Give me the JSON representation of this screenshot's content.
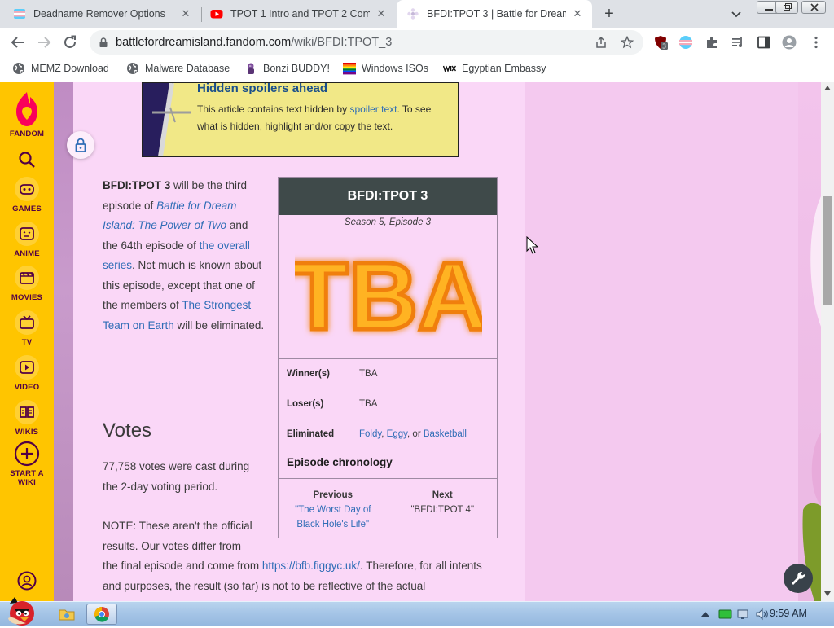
{
  "browser": {
    "tabs": [
      {
        "title": "Deadname Remover Options",
        "favicon": "trans-flag-icon"
      },
      {
        "title": "TPOT 1 Intro and TPOT 2 Com",
        "favicon": "youtube-icon"
      },
      {
        "title": "BFDI:TPOT 3 | Battle for Dream",
        "favicon": "fandom-flower-icon",
        "active": true
      }
    ],
    "url_host": "battlefordreamisland.fandom.com",
    "url_path": "/wiki/BFDI:TPOT_3",
    "extension_badge": "3"
  },
  "bookmarks": [
    {
      "label": "MEMZ Download",
      "icon": "globe-icon"
    },
    {
      "label": "Malware Database",
      "icon": "globe-icon"
    },
    {
      "label": "Bonzi BUDDY!",
      "icon": "bonzi-icon"
    },
    {
      "label": "Windows ISOs",
      "icon": "rainbow-flag-icon"
    },
    {
      "label": "Egyptian Embassy",
      "icon": "wix-icon"
    }
  ],
  "fandom_sidebar": {
    "brand": "FANDOM",
    "items": [
      {
        "label": "GAMES",
        "icon": "games-icon"
      },
      {
        "label": "ANIME",
        "icon": "anime-icon"
      },
      {
        "label": "MOVIES",
        "icon": "movies-icon"
      },
      {
        "label": "TV",
        "icon": "tv-icon"
      },
      {
        "label": "VIDEO",
        "icon": "video-icon"
      },
      {
        "label": "WIKIS",
        "icon": "wikis-icon"
      }
    ],
    "start_wiki": "START A WIKI"
  },
  "spoiler": {
    "heading": "Hidden spoilers ahead",
    "text_before": "This article contains text hidden by ",
    "link": "spoiler text",
    "text_after": ". To see what is hidden, highlight and/or copy the text."
  },
  "article": {
    "subject": "BFDI:TPOT 3",
    "t1": " will be the third episode of ",
    "link1": "Battle for Dream Island: The Power of Two",
    "t2": " and the 64th episode of ",
    "link2": "the overall series",
    "t3": ". Not much is known about this episode, except that one of the members of ",
    "link3": "The Strongest Team on Earth",
    "t4": " will be eliminated."
  },
  "infobox": {
    "title": "BFDI:TPOT 3",
    "subtitle": "Season 5, Episode 3",
    "image_text": "TBA",
    "rows": [
      {
        "key": "Winner(s)",
        "value": "TBA"
      },
      {
        "key": "Loser(s)",
        "value": "TBA"
      }
    ],
    "eliminated_key": "Eliminated",
    "eliminated": [
      "Foldy",
      "Eggy",
      "Basketball"
    ],
    "eliminated_sep1": ", ",
    "eliminated_sep2": ", or ",
    "chronology_heading": "Episode chronology",
    "previous_label": "Previous",
    "previous_value": "\"The Worst Day of Black Hole's Life\"",
    "next_label": "Next",
    "next_value": "\"BFDI:TPOT 4\""
  },
  "votes": {
    "heading": "Votes",
    "summary": "77,758 votes were cast during the 2-day voting period.",
    "note_start": "NOTE: These aren't the official results. Our votes differ from",
    "note_cont": "the final episode and come from ",
    "note_link": "https://bfb.figgyc.uk/",
    "note_end": ". Therefore, for all intents and purposes, the result (so far) is not to be reflective of the actual"
  },
  "taskbar": {
    "time": "9:59 AM"
  }
}
